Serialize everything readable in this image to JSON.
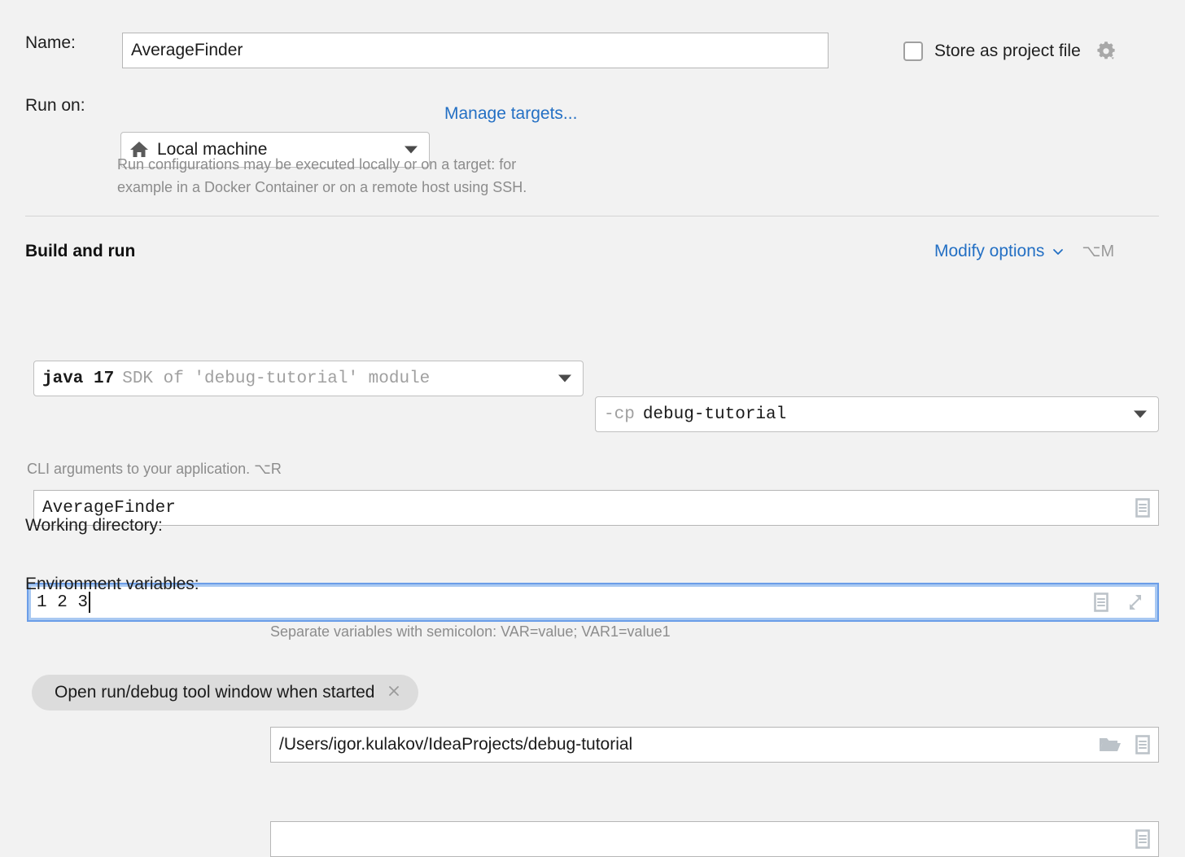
{
  "name_row": {
    "label": "Name:",
    "value": "AverageFinder",
    "placeholder": "Name"
  },
  "store_as_project_file": {
    "label": "Store as project file",
    "checked": false,
    "gear_icon": "gear-dropdown-icon"
  },
  "run_on_row": {
    "label": "Run on:",
    "selected": "Local machine",
    "machine_icon": "home-icon",
    "manage_targets_link": "Manage targets...",
    "description_line1": "Run configurations may be executed locally or on a target: for",
    "description_line2": "example in a Docker Container or on a remote host using SSH."
  },
  "build_and_run": {
    "section_title": "Build and run",
    "modify_options_label": "Modify options",
    "modify_options_shortcut": "⌥M",
    "jdk": {
      "primary": "java 17",
      "secondary": "SDK of 'debug-tutorial' module"
    },
    "classpath": {
      "prefix": "-cp",
      "value": "debug-tutorial"
    },
    "main_class": {
      "value": "AverageFinder",
      "icon": "expand-list-icon"
    },
    "program_arguments": {
      "value": "1 2 3",
      "focused": true,
      "icons": [
        "expand-list-icon",
        "expand-fullscreen-icon"
      ],
      "hint": "CLI arguments to your application. ⌥R"
    }
  },
  "working_directory": {
    "label": "Working directory:",
    "value": "/Users/igor.kulakov/IdeaProjects/debug-tutorial",
    "icons": [
      "folder-icon",
      "expand-list-icon"
    ]
  },
  "environment_variables": {
    "label": "Environment variables:",
    "value": "",
    "icons": [
      "expand-list-icon"
    ],
    "hint": "Separate variables with semicolon: VAR=value; VAR1=value1"
  },
  "open_tool_window_chip": {
    "label": "Open run/debug tool window when started",
    "close_icon": "close-icon"
  },
  "colors": {
    "background": "#f2f2f2",
    "link": "#2470c4",
    "focus_border": "#6b9ee8",
    "muted_text": "#8c8c8c"
  }
}
